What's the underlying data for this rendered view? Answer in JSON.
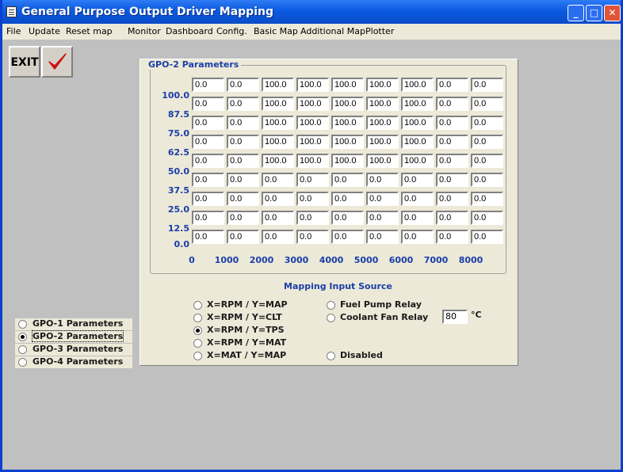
{
  "window": {
    "title": "General Purpose Output Driver Mapping",
    "min_glyph": "_",
    "max_glyph": "□",
    "close_glyph": "✕"
  },
  "menu": [
    "File",
    "Update",
    "Reset map",
    "Monitor",
    "Dashboard",
    "Config.",
    "Basic Map",
    "Additional Map",
    "Plotter"
  ],
  "toolbar": {
    "exit_label": "EXIT",
    "check_icon": "checkmark-icon"
  },
  "gpo_panel": {
    "title": "GPO-2 Parameters",
    "y_labels": [
      "100.0",
      "87.5",
      "75.0",
      "62.5",
      "50.0",
      "37.5",
      "25.0",
      "12.5",
      "0.0"
    ],
    "x_labels": [
      "0",
      "1000",
      "2000",
      "3000",
      "4000",
      "5000",
      "6000",
      "7000",
      "8000"
    ],
    "grid": [
      [
        "0.0",
        "0.0",
        "100.0",
        "100.0",
        "100.0",
        "100.0",
        "100.0",
        "0.0",
        "0.0"
      ],
      [
        "0.0",
        "0.0",
        "100.0",
        "100.0",
        "100.0",
        "100.0",
        "100.0",
        "0.0",
        "0.0"
      ],
      [
        "0.0",
        "0.0",
        "100.0",
        "100.0",
        "100.0",
        "100.0",
        "100.0",
        "0.0",
        "0.0"
      ],
      [
        "0.0",
        "0.0",
        "100.0",
        "100.0",
        "100.0",
        "100.0",
        "100.0",
        "0.0",
        "0.0"
      ],
      [
        "0.0",
        "0.0",
        "100.0",
        "100.0",
        "100.0",
        "100.0",
        "100.0",
        "0.0",
        "0.0"
      ],
      [
        "0.0",
        "0.0",
        "0.0",
        "0.0",
        "0.0",
        "0.0",
        "0.0",
        "0.0",
        "0.0"
      ],
      [
        "0.0",
        "0.0",
        "0.0",
        "0.0",
        "0.0",
        "0.0",
        "0.0",
        "0.0",
        "0.0"
      ],
      [
        "0.0",
        "0.0",
        "0.0",
        "0.0",
        "0.0",
        "0.0",
        "0.0",
        "0.0",
        "0.0"
      ],
      [
        "0.0",
        "0.0",
        "0.0",
        "0.0",
        "0.0",
        "0.0",
        "0.0",
        "0.0",
        "0.0"
      ]
    ]
  },
  "mapping_source": {
    "title": "Mapping Input Source",
    "left_options": [
      {
        "label": "X=RPM / Y=MAP",
        "checked": false
      },
      {
        "label": "X=RPM / Y=CLT",
        "checked": false
      },
      {
        "label": "X=RPM / Y=TPS",
        "checked": true
      },
      {
        "label": "X=RPM / Y=MAT",
        "checked": false
      },
      {
        "label": "X=MAT / Y=MAP",
        "checked": false
      }
    ],
    "fuel_pump_label": "Fuel Pump Relay",
    "coolant_fan_label": "Coolant Fan Relay",
    "coolant_temp_value": "80",
    "temp_unit": "°C",
    "disabled_label": "Disabled"
  },
  "gpo_selector": [
    {
      "label": "GPO-1 Parameters",
      "checked": false
    },
    {
      "label": "GPO-2 Parameters",
      "checked": true
    },
    {
      "label": "GPO-3 Parameters",
      "checked": false
    },
    {
      "label": "GPO-4 Parameters",
      "checked": false
    }
  ]
}
